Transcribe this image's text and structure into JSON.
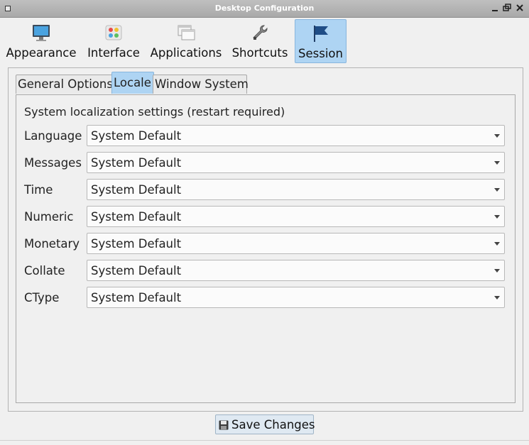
{
  "window": {
    "title": "Desktop Configuration",
    "menu_icon": "window-menu-icon",
    "controls": [
      "minimize-icon",
      "maximize-icon",
      "close-icon"
    ]
  },
  "toolbar": {
    "items": [
      {
        "label": "Appearance",
        "icon": "monitor-icon",
        "active": false
      },
      {
        "label": "Interface",
        "icon": "palette-icon",
        "active": false
      },
      {
        "label": "Applications",
        "icon": "windows-icon",
        "active": false
      },
      {
        "label": "Shortcuts",
        "icon": "wrench-icon",
        "active": false
      },
      {
        "label": "Session",
        "icon": "flag-icon",
        "active": true
      }
    ]
  },
  "tabs": [
    {
      "label": "General Options",
      "active": false
    },
    {
      "label": "Locale",
      "active": true
    },
    {
      "label": "Window System",
      "active": false
    }
  ],
  "locale": {
    "heading": "System localization settings (restart required)",
    "rows": [
      {
        "label": "Language",
        "value": "System Default"
      },
      {
        "label": "Messages",
        "value": "System Default"
      },
      {
        "label": "Time",
        "value": "System Default"
      },
      {
        "label": "Numeric",
        "value": "System Default"
      },
      {
        "label": "Monetary",
        "value": "System Default"
      },
      {
        "label": "Collate",
        "value": "System Default"
      },
      {
        "label": "CType",
        "value": "System Default"
      }
    ]
  },
  "footer": {
    "save_label": "Save Changes",
    "save_icon": "floppy-disk-icon"
  },
  "colors": {
    "accent": "#aed4f3",
    "accent_border": "#88b6de",
    "background": "#f0f0f0"
  }
}
